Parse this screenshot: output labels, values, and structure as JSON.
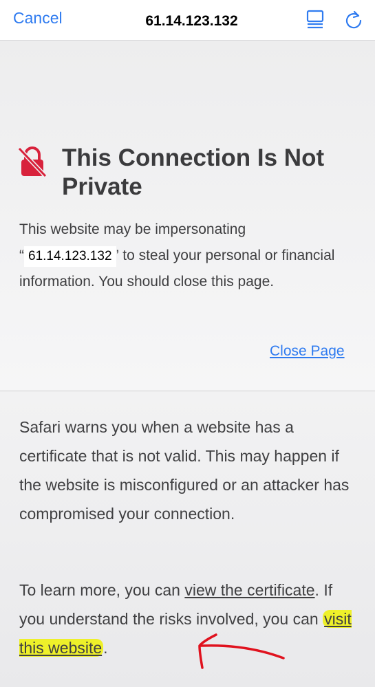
{
  "topbar": {
    "cancel_label": "Cancel",
    "url": "61.14.123.132",
    "reader_icon": "reader-list-icon",
    "reload_icon": "reload-icon"
  },
  "warning": {
    "lock_icon": "lock-slash-icon",
    "title_line1": "This Connection Is Not",
    "title_line2": "Private",
    "text_before": "This website may be impersonating",
    "quote_open": "“",
    "ip": "61.14.123.132",
    "quote_close": "’",
    "text_after": " to steal your personal or financial information. You should close this page.",
    "close_page_label": "Close Page"
  },
  "details": {
    "paragraph1": "Safari warns you when a website has a certificate that is not valid. This may happen if the website is misconfigured or an attacker has compromised your connection.",
    "p2_before": "To learn more, you can ",
    "view_certificate_label": "view the certificate",
    "p2_middle": ". If you understand the risks involved, you can ",
    "visit_website_label": "visit this website",
    "p2_end": "."
  },
  "colors": {
    "accent": "#2f7bf0",
    "lock_red": "#d8223c",
    "highlight": "#eef02a",
    "annotation_arrow": "#e0121e"
  }
}
